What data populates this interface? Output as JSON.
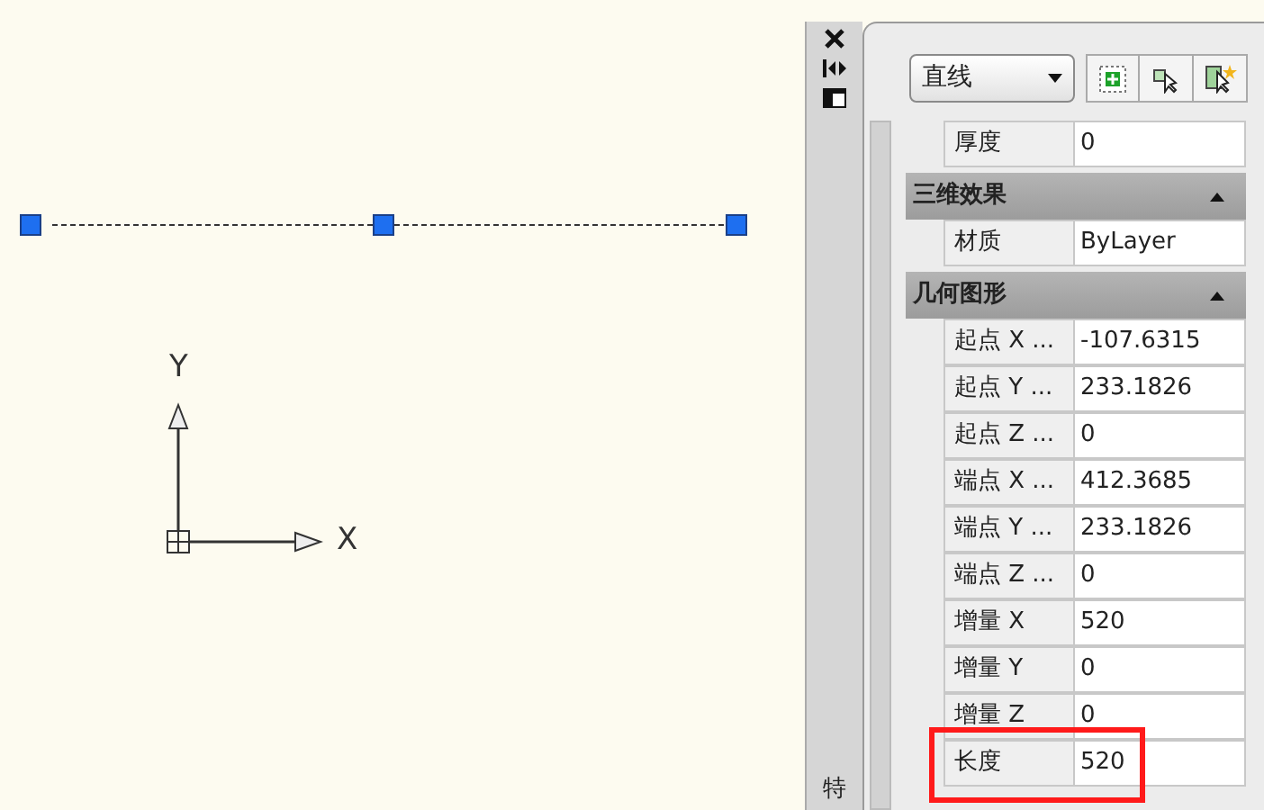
{
  "drawing": {
    "ucs": {
      "x_label": "X",
      "y_label": "Y"
    }
  },
  "palette": {
    "tab_title": "特",
    "object_type": "直线",
    "rows": [
      {
        "kind": "property",
        "label": "厚度",
        "value": "0",
        "highlighted": false
      },
      {
        "kind": "category",
        "label": "三维效果",
        "expanded": true
      },
      {
        "kind": "property",
        "label": "材质",
        "value": "ByLayer",
        "highlighted": false
      },
      {
        "kind": "category",
        "label": "几何图形",
        "expanded": true
      },
      {
        "kind": "property",
        "label": "起点 X ...",
        "value": "-107.6315",
        "highlighted": false
      },
      {
        "kind": "property",
        "label": "起点 Y ...",
        "value": "233.1826",
        "highlighted": false
      },
      {
        "kind": "property",
        "label": "起点 Z ...",
        "value": "0",
        "highlighted": false
      },
      {
        "kind": "property",
        "label": "端点 X ...",
        "value": "412.3685",
        "highlighted": false
      },
      {
        "kind": "property",
        "label": "端点 Y ...",
        "value": "233.1826",
        "highlighted": false
      },
      {
        "kind": "property",
        "label": "端点 Z ...",
        "value": "0",
        "highlighted": false
      },
      {
        "kind": "property",
        "label": "增量 X",
        "value": "520",
        "highlighted": false
      },
      {
        "kind": "property",
        "label": "增量 Y",
        "value": "0",
        "highlighted": false
      },
      {
        "kind": "property",
        "label": "增量 Z",
        "value": "0",
        "highlighted": false
      },
      {
        "kind": "property",
        "label": "长度",
        "value": "520",
        "highlighted": true
      }
    ]
  }
}
